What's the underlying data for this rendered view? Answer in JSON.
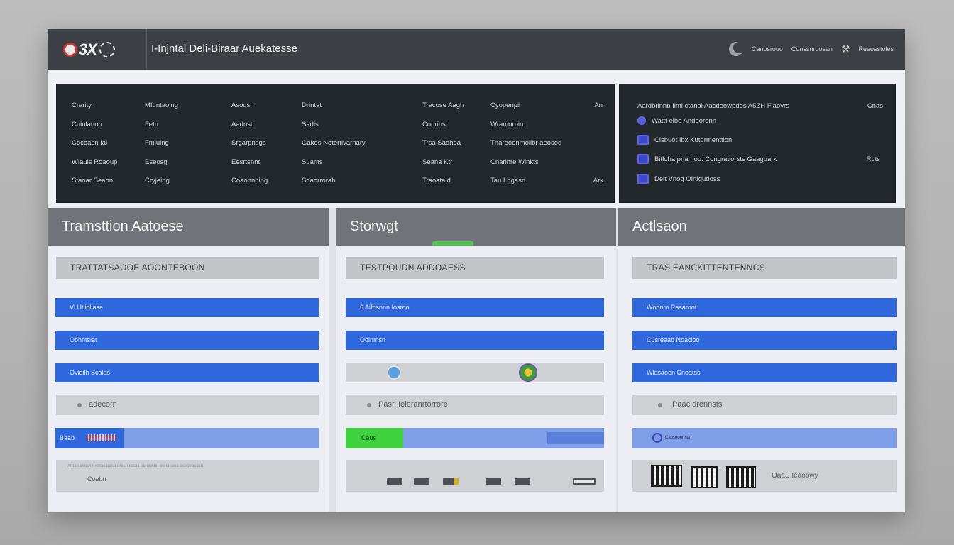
{
  "titlebar": {
    "logo_text": "3X",
    "title": "I-Injntal Deli-Biraar Auekatesse",
    "right_items": [
      "Canosrouo",
      "Conssnroosan",
      "Reeosstoles"
    ]
  },
  "grid": {
    "rows": [
      [
        "Crarity",
        "Mfuntaoing",
        "Asodsn",
        "Drintat",
        "Tracose Aagh",
        "Cyopenpil",
        "Arr"
      ],
      [
        "Cuinlanon",
        "Fetn",
        "Aadnst",
        "Sadis",
        "Conrins",
        "Wramorpin",
        ""
      ],
      [
        "Cocoasn Ial",
        "Fmiuing",
        "Srgarpnsgs",
        "Gakos Notertlvarnary",
        "Trsa Saohoa",
        "Tnareoenmolibr aeosod",
        ""
      ],
      [
        "Wiauis Roaoup",
        "Eseosg",
        "Eesrtsnnt",
        "Suarits",
        "Seana Ktr",
        "Cnarlnre Winkts",
        ""
      ],
      [
        "Staoar Seaon",
        "Cryjeing",
        "Coaonnning",
        "Soaorrorab",
        "Traoatald",
        "Tau Lngasn",
        "Ark"
      ]
    ]
  },
  "activity": {
    "header": "Aardbrlnnb Iiml ctanal Aacdeowpdes A5ZH Fiaovrs",
    "header_right": "Cnas",
    "items": [
      {
        "label": "Wattt elbe Andooronn",
        "right": ""
      },
      {
        "label": "Cisbuot Ibx Kutgrmenttion",
        "right": ""
      },
      {
        "label": "Bitloha pnamoo: Congratiorsts Gaagbark",
        "right": "Ruts"
      },
      {
        "label": "Deit Vnog Oirtigudoss",
        "right": ""
      }
    ]
  },
  "columns": [
    {
      "title": "Tramsttion Aatoese",
      "subhead": "TRATTATSAOOE AOONTEBOON",
      "bars": [
        "Vl Utlidliase",
        "Oohntslat",
        "Ovidilh Scalas"
      ],
      "grey": "adecorn",
      "light_label": "Baab",
      "foot": "Coabn",
      "foot_top": "Aroa sasosn Ieenaeanrsa eresnobsaa oarounnn ounanaea eseoeaeasn"
    },
    {
      "title": "Storwgt",
      "subhead": "TESTPOUDN ADDOAESS",
      "bars": [
        "6 Aifbsnnn Iosroo",
        "Ooinmsn"
      ],
      "grey": "Pasr. Ieleranrtorrore",
      "light_label": "Caus"
    },
    {
      "title": "Actlsaon",
      "subhead": "TRAS EANCKITTENTENNCS",
      "bars": [
        "Woonro Rasaroot",
        "Cusreaab Noacloo",
        "Wlasaoen Cnoatss"
      ],
      "grey": "Paac drennsts",
      "light_label": "Caosooonnan",
      "foot": "OaaS Ieaoowy"
    }
  ],
  "colors": {
    "titlebar": "#3c3f44",
    "panel_dark": "#23282d",
    "accent_blue": "#2f68dd",
    "accent_green": "#3fd13f",
    "column_header": "#707377"
  }
}
